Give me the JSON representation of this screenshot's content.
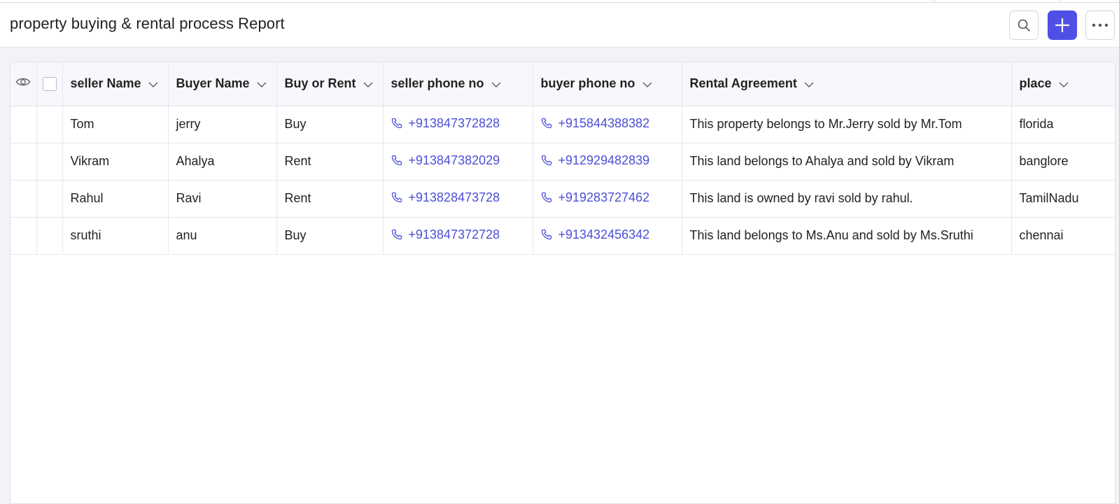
{
  "header": {
    "title": "property buying & rental process Report",
    "search_icon": "search-icon",
    "add_icon": "plus-icon",
    "more_icon": "more-horizontal-icon",
    "accent_color": "#4f4fe6"
  },
  "table": {
    "columns": [
      {
        "label": "seller Name"
      },
      {
        "label": "Buyer Name"
      },
      {
        "label": "Buy or Rent"
      },
      {
        "label": "seller phone no"
      },
      {
        "label": "buyer phone no"
      },
      {
        "label": "Rental Agreement"
      },
      {
        "label": "place"
      }
    ],
    "rows": [
      {
        "seller": "Tom",
        "buyer": "jerry",
        "type": "Buy",
        "seller_phone": "+913847372828",
        "buyer_phone": "+915844388382",
        "agreement": "This property belongs to Mr.Jerry sold by Mr.Tom",
        "place": "florida"
      },
      {
        "seller": "Vikram",
        "buyer": "Ahalya",
        "type": "Rent",
        "seller_phone": "+913847382029",
        "buyer_phone": "+912929482839",
        "agreement": "This land belongs to Ahalya and sold by Vikram",
        "place": "banglore"
      },
      {
        "seller": "Rahul",
        "buyer": "Ravi",
        "type": "Rent",
        "seller_phone": "+913828473728",
        "buyer_phone": "+919283727462",
        "agreement": "This land is owned by ravi sold by rahul.",
        "place": "TamilNadu"
      },
      {
        "seller": "sruthi",
        "buyer": "anu",
        "type": "Buy",
        "seller_phone": "+913847372728",
        "buyer_phone": "+913432456342",
        "agreement": "This land belongs to Ms.Anu and sold by Ms.Sruthi",
        "place": "chennai"
      }
    ],
    "phone_color": "#4c4fd6"
  }
}
